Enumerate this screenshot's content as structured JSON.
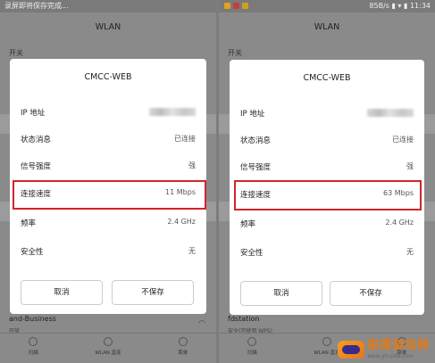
{
  "left": {
    "statusbar": {
      "text": "录屏即将保存完成..."
    },
    "title": "WLAN",
    "section_label": "开关",
    "bg_network": {
      "name": "and-Business",
      "sub": "开放"
    },
    "dialog": {
      "title": "CMCC-WEB",
      "rows": [
        {
          "label": "IP 地址",
          "value": ""
        },
        {
          "label": "状态消息",
          "value": "已连接"
        },
        {
          "label": "信号强度",
          "value": "强"
        },
        {
          "label": "连接速度",
          "value": "11 Mbps"
        },
        {
          "label": "频率",
          "value": "2.4 GHz"
        },
        {
          "label": "安全性",
          "value": "无"
        }
      ],
      "cancel": "取消",
      "dont_save": "不保存"
    },
    "nav": [
      "扫描",
      "WLAN 直连",
      "菜单"
    ]
  },
  "right": {
    "statusbar": {
      "speed": "85B/s",
      "time": "11:34"
    },
    "title": "WLAN",
    "section_label": "开关",
    "bg_network": {
      "name": "fdstation",
      "sub": "安全(可使用 WPS)"
    },
    "dialog": {
      "title": "CMCC-WEB",
      "rows": [
        {
          "label": "IP 地址",
          "value": ""
        },
        {
          "label": "状态消息",
          "value": "已连接"
        },
        {
          "label": "信号强度",
          "value": "强"
        },
        {
          "label": "连接速度",
          "value": "63  Mbps"
        },
        {
          "label": "频率",
          "value": "2.4 GHz"
        },
        {
          "label": "安全性",
          "value": "无"
        }
      ],
      "cancel": "取消",
      "dont_save": "不保存"
    },
    "nav": [
      "扫描",
      "WLAN 直连",
      "菜单"
    ]
  },
  "watermark": {
    "text": "锐得游戏网",
    "url": "www.ytruida.com"
  },
  "colors": {
    "highlight": "#d2242a",
    "watermark_orange": "#e57a12"
  }
}
